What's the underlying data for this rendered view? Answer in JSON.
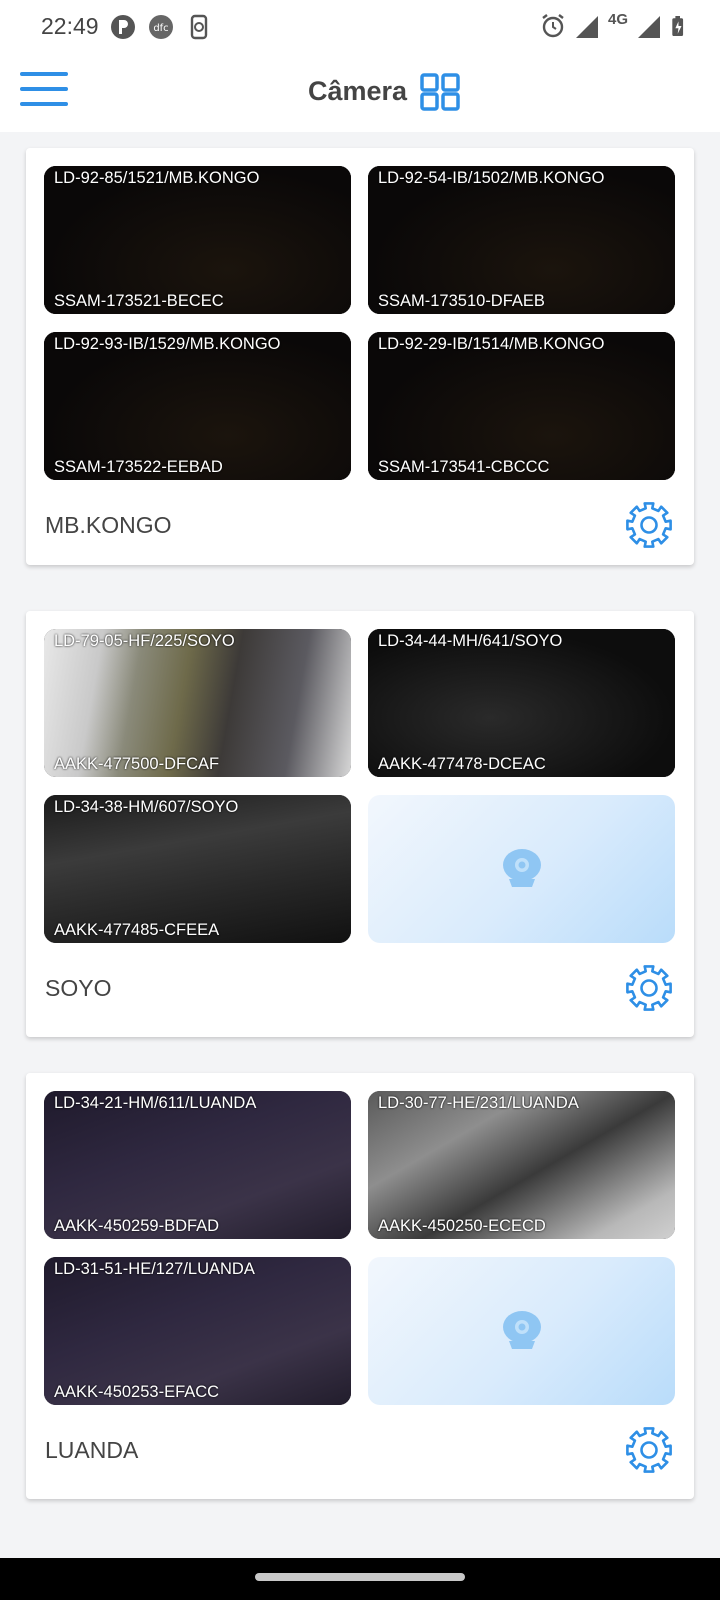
{
  "status_bar": {
    "time": "22:49",
    "network_label": "4G",
    "left_icons": [
      "p-circle-icon",
      "dfc-circle-icon",
      "phone-sync-icon"
    ],
    "right_icons": [
      "alarm-icon",
      "signal-icon",
      "signal-4g-icon",
      "battery-charging-icon"
    ]
  },
  "app_bar": {
    "title": "Câmera",
    "accent": "#2e8fe6"
  },
  "groups": [
    {
      "name": "MB.KONGO",
      "cameras": [
        {
          "name": "LD-92-85/1521/MB.KONGO",
          "id": "SSAM-173521-BECEC",
          "feed": "dark-night"
        },
        {
          "name": "LD-92-54-IB/1502/MB.KONGO",
          "id": "SSAM-173510-DFAEB",
          "feed": "dark-night"
        },
        {
          "name": "LD-92-93-IB/1529/MB.KONGO",
          "id": "SSAM-173522-EEBAD",
          "feed": "dark-night"
        },
        {
          "name": "LD-92-29-IB/1514/MB.KONGO",
          "id": "SSAM-173541-CBCCC",
          "feed": "dark-night"
        }
      ]
    },
    {
      "name": "SOYO",
      "cameras": [
        {
          "name": "LD-79-05-HF/225/SOYO",
          "id": "AAKK-477500-DFCAF",
          "feed": "bus-day"
        },
        {
          "name": "LD-34-44-MH/641/SOYO",
          "id": "AAKK-477478-DCEAC",
          "feed": "bus-night"
        },
        {
          "name": "LD-34-38-HM/607/SOYO",
          "id": "AAKK-477485-CFEEA",
          "feed": "bus-night-grey"
        },
        {
          "name": "",
          "id": "",
          "feed": "empty"
        }
      ]
    },
    {
      "name": "LUANDA",
      "cameras": [
        {
          "name": "LD-34-21-HM/611/LUANDA",
          "id": "AAKK-450259-BDFAD",
          "feed": "bus-purple"
        },
        {
          "name": "LD-30-77-HE/231/LUANDA",
          "id": "AAKK-450250-ECECD",
          "feed": "bus-day-grey"
        },
        {
          "name": "LD-31-51-HE/127/LUANDA",
          "id": "AAKK-450253-EFACC",
          "feed": "bus-purple"
        },
        {
          "name": "",
          "id": "",
          "feed": "empty"
        }
      ]
    }
  ]
}
